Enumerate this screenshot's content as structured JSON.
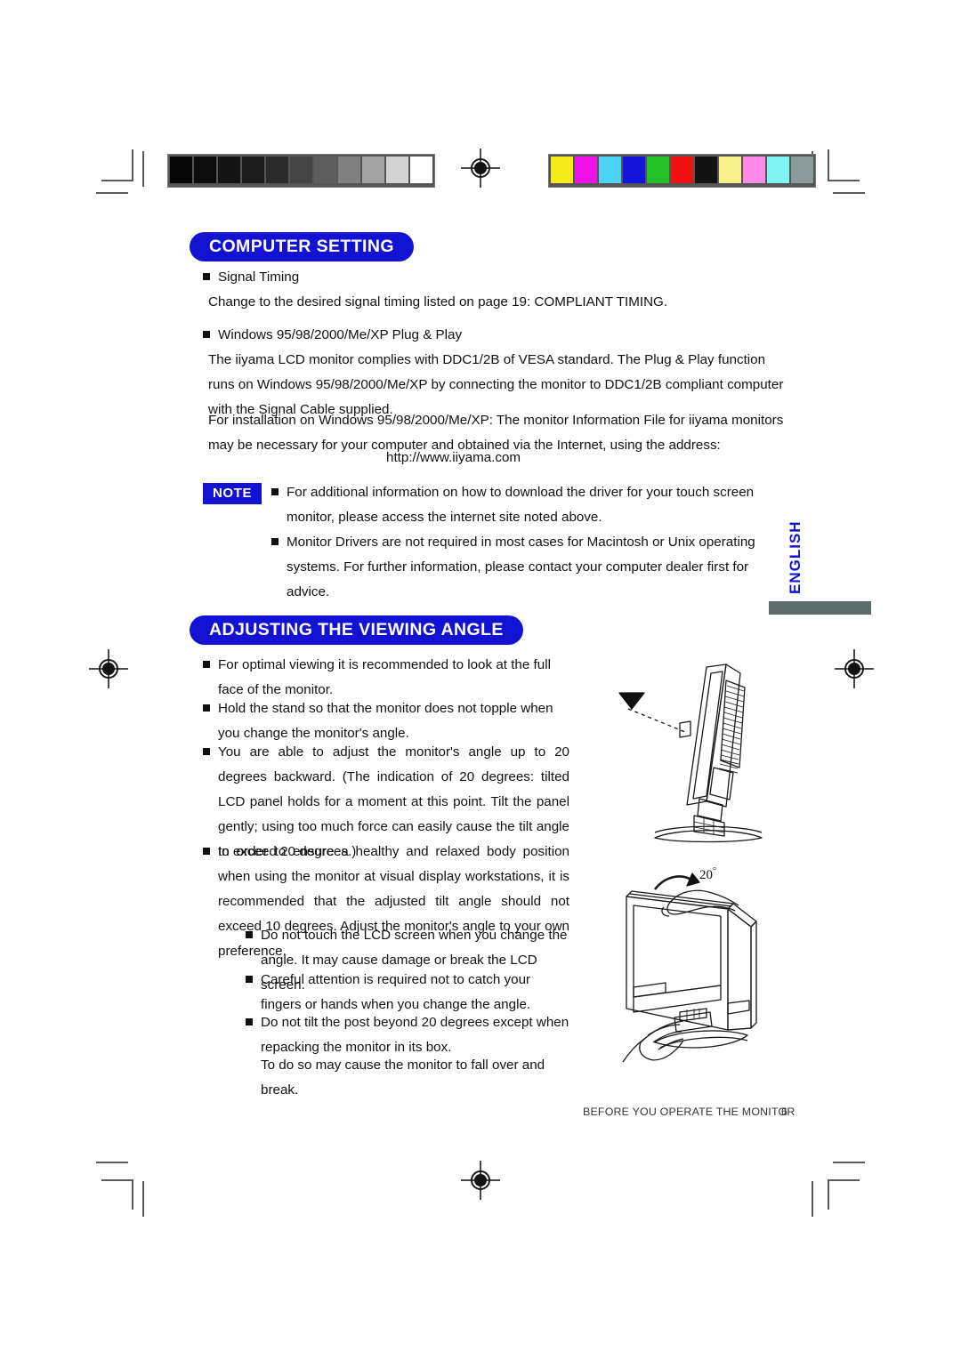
{
  "document": {
    "page_number": "6",
    "footer_text": "BEFORE YOU OPERATE THE MONITOR",
    "language_tab": "ENGLISH"
  },
  "colors": {
    "heading_blue": "#1212d2",
    "note_blue": "#1212d2",
    "english_bar_gray": "#5d6b6b",
    "text_black": "#111111"
  },
  "print_marks": {
    "grayscale_swatches": [
      "#050505",
      "#0c0c0c",
      "#141414",
      "#1d1d1d",
      "#2b2b2b",
      "#444444",
      "#5e5e5e",
      "#808080",
      "#a3a3a3",
      "#d2d2d2",
      "#ffffff"
    ],
    "color_swatches": [
      "#f3ec1b",
      "#f010e8",
      "#4cd3f5",
      "#1414e0",
      "#22c32a",
      "#f01010",
      "#121212",
      "#f8f08a",
      "#ff8ae8",
      "#7df3f3",
      "#8b9b9b"
    ],
    "registration_target_name": "registration-target"
  },
  "sections": [
    {
      "id": "computer-setting",
      "heading": "COMPUTER SETTING",
      "items": [
        {
          "type": "bullet",
          "text": "Signal Timing"
        },
        {
          "type": "body",
          "text": "Change to the desired signal timing listed on page 19: COMPLIANT TIMING."
        },
        {
          "type": "bullet",
          "text": "Windows 95/98/2000/Me/XP Plug & Play"
        },
        {
          "type": "body",
          "text": "The iiyama LCD monitor complies with DDC1/2B of VESA standard. The Plug & Play function runs on Windows 95/98/2000/Me/XP by connecting the monitor to DDC1/2B compliant computer with the Signal Cable supplied."
        },
        {
          "type": "body",
          "text": "For installation on Windows 95/98/2000/Me/XP: The monitor Information File for iiyama monitors may be necessary for your computer and obtained via the Internet, using the address:"
        },
        {
          "type": "url",
          "text": "http://www.iiyama.com"
        }
      ],
      "note": {
        "label": "NOTE",
        "bullets": [
          "For additional information on how to download the driver for your touch screen monitor, please access the internet site noted above.",
          "Monitor Drivers are not required in most cases for Macintosh or Unix operating systems. For further information, please contact your computer dealer first for advice."
        ]
      }
    },
    {
      "id": "adjusting-the-viewing-angle",
      "heading": "ADJUSTING THE VIEWING ANGLE",
      "bullets": [
        "For optimal viewing it is recommended to look at the full face of the monitor.",
        "Hold the stand so that the monitor does not topple when you change the monitor's angle.",
        "You are able to adjust the monitor's angle up to 20 degrees backward. (The indication of  20 degrees: tilted LCD panel holds for a moment at this point. Tilt the panel gently; using too much force can easily cause the tilt angle to exceed 20 degrees.)",
        "In order to ensure a healthy and relaxed body position when using the monitor at visual display workstations, it is recommended that the adjusted tilt angle should not exceed 10 degrees. Adjust the monitor's angle to your own preference."
      ],
      "sub_bullets": [
        "Do not touch the LCD screen when you change the angle. It may cause damage or break the LCD screen.",
        "Careful attention is required not to catch your fingers or hands when you change the angle.",
        "Do not tilt the post beyond 20 degrees except when repacking the monitor in its box."
      ],
      "sub_trailing_text": "To do so may cause the monitor to fall over and break.",
      "figures": [
        {
          "name": "monitor-side-view-figure",
          "label": ""
        },
        {
          "name": "monitor-tilt-figure",
          "label": "20°"
        }
      ]
    }
  ]
}
